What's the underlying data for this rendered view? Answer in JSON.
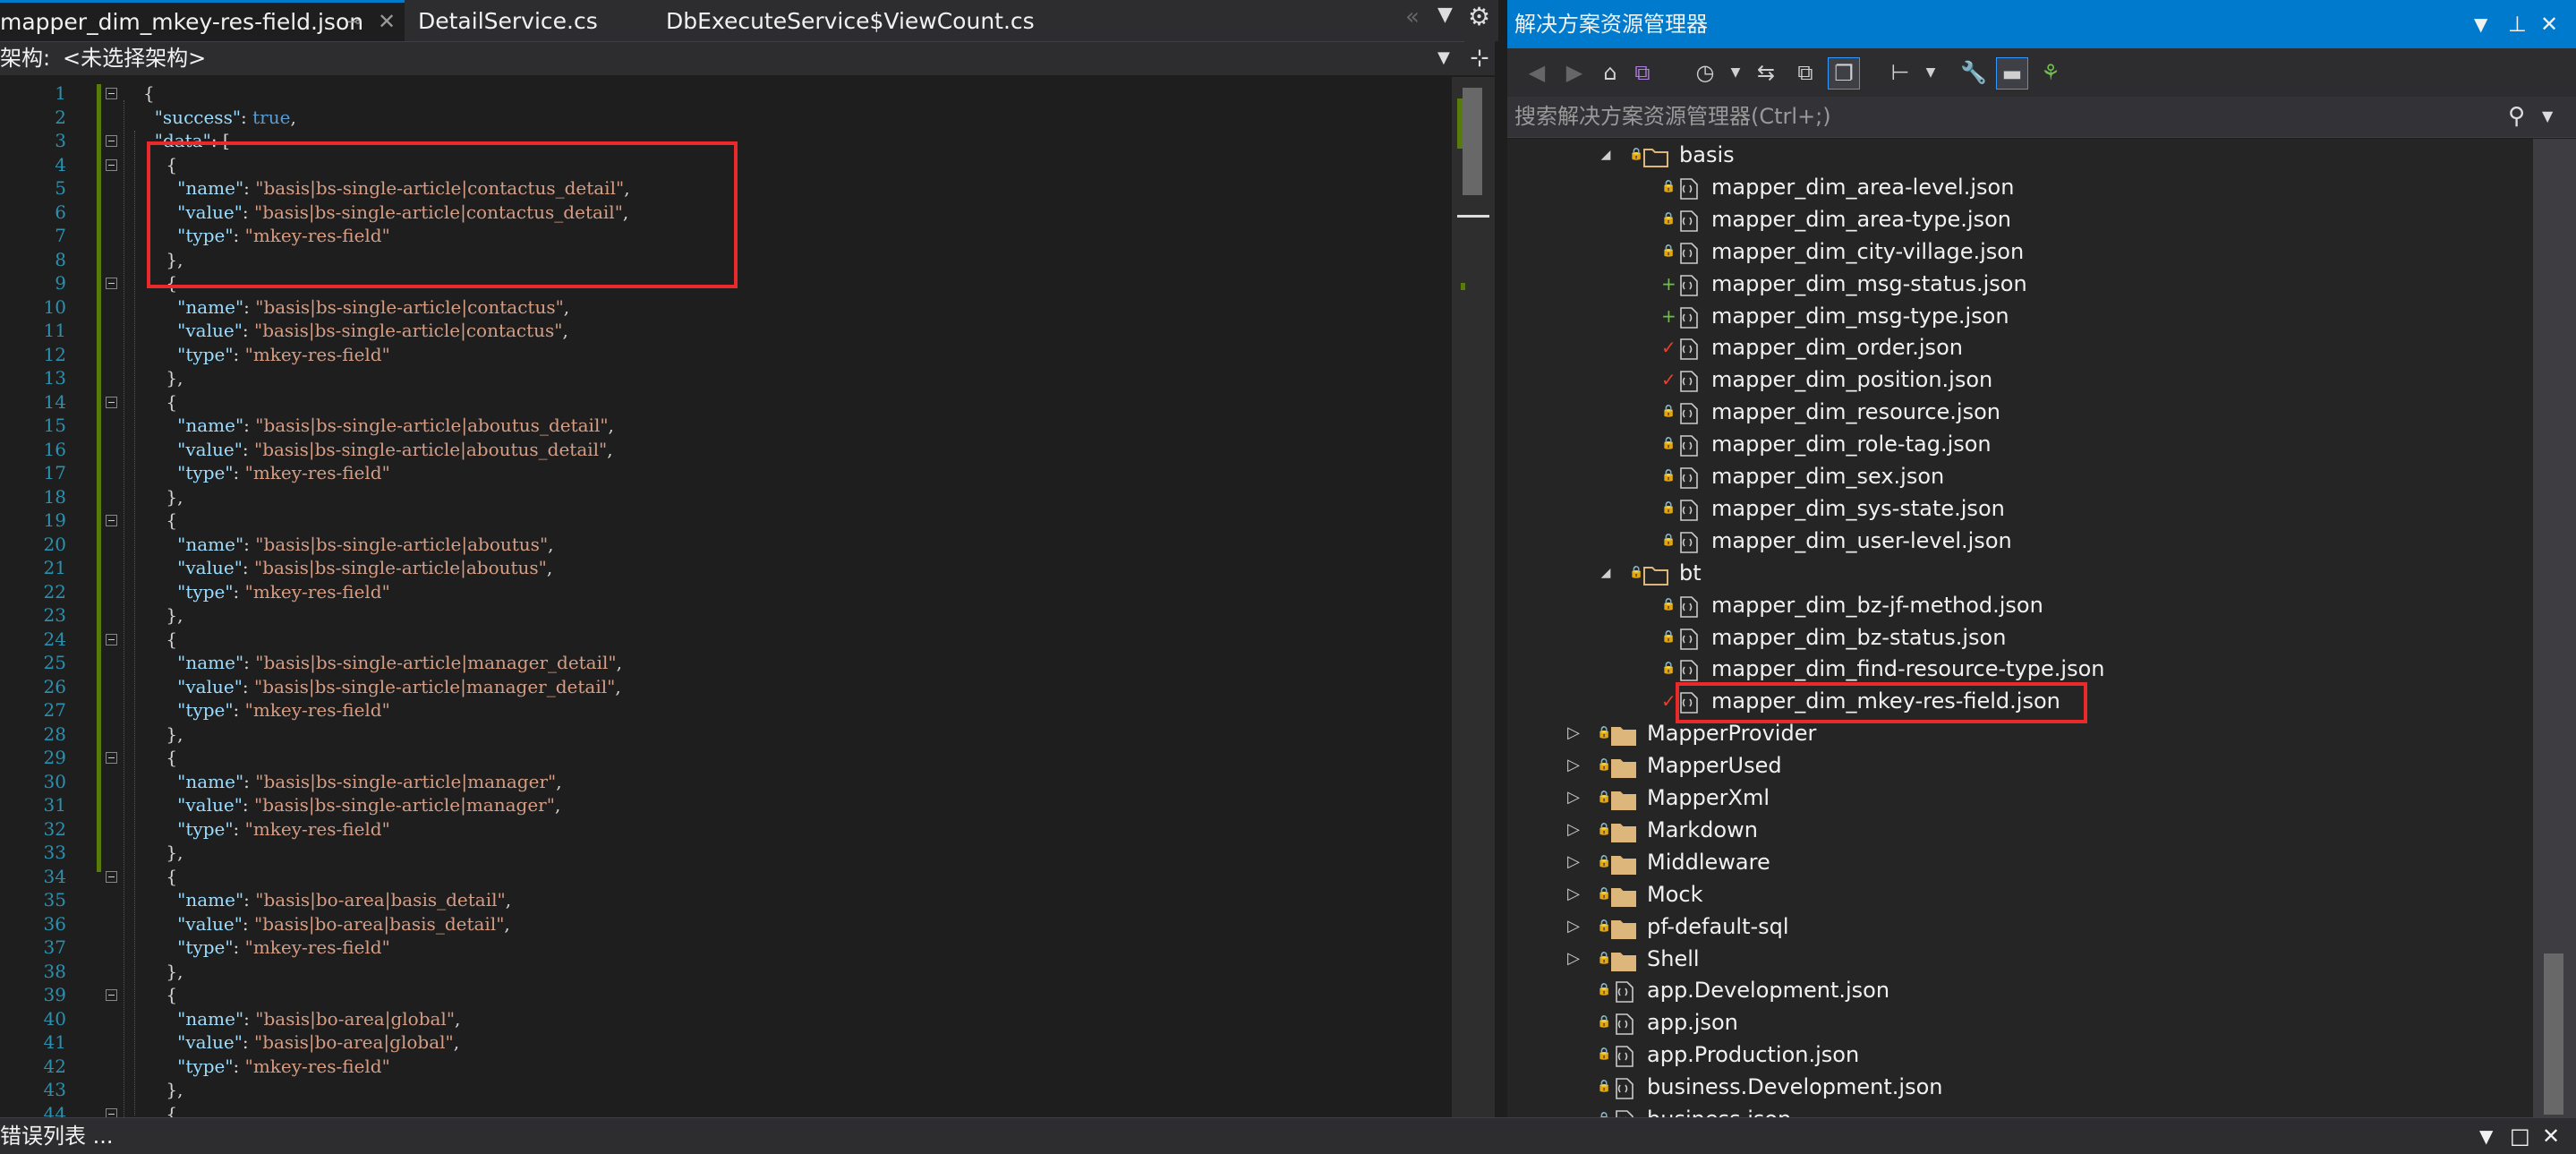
{
  "editor": {
    "tabs": [
      {
        "label": "mapper_dim_mkey-res-field.json"
      },
      {
        "label": "DetailService.cs"
      },
      {
        "label": "DbExecuteService$ViewCount.cs"
      }
    ],
    "nav_label": "架构:",
    "nav_value": "<未选择架构>",
    "lines": [
      {
        "n": "1",
        "t": [
          {
            "c": "",
            "v": "{"
          }
        ]
      },
      {
        "n": "2",
        "t": [
          {
            "c": "",
            "v": "  "
          },
          {
            "c": "k",
            "v": "\"success\""
          },
          {
            "c": "",
            "v": ": "
          },
          {
            "c": "b",
            "v": "true"
          },
          {
            "c": "",
            "v": ","
          }
        ]
      },
      {
        "n": "3",
        "t": [
          {
            "c": "",
            "v": "  "
          },
          {
            "c": "k",
            "v": "\"data\""
          },
          {
            "c": "",
            "v": ": ["
          }
        ]
      },
      {
        "n": "4",
        "t": [
          {
            "c": "",
            "v": "    {"
          }
        ]
      },
      {
        "n": "5",
        "t": [
          {
            "c": "",
            "v": "      "
          },
          {
            "c": "k",
            "v": "\"name\""
          },
          {
            "c": "",
            "v": ": "
          },
          {
            "c": "s",
            "v": "\"basis|bs-single-article|contactus_detail\""
          },
          {
            "c": "",
            "v": ","
          }
        ]
      },
      {
        "n": "6",
        "t": [
          {
            "c": "",
            "v": "      "
          },
          {
            "c": "k",
            "v": "\"value\""
          },
          {
            "c": "",
            "v": ": "
          },
          {
            "c": "s",
            "v": "\"basis|bs-single-article|contactus_detail\""
          },
          {
            "c": "",
            "v": ","
          }
        ]
      },
      {
        "n": "7",
        "t": [
          {
            "c": "",
            "v": "      "
          },
          {
            "c": "k",
            "v": "\"type\""
          },
          {
            "c": "",
            "v": ": "
          },
          {
            "c": "s",
            "v": "\"mkey-res-field\""
          }
        ]
      },
      {
        "n": "8",
        "t": [
          {
            "c": "",
            "v": "    },"
          }
        ]
      },
      {
        "n": "9",
        "t": [
          {
            "c": "",
            "v": "    {"
          }
        ]
      },
      {
        "n": "10",
        "t": [
          {
            "c": "",
            "v": "      "
          },
          {
            "c": "k",
            "v": "\"name\""
          },
          {
            "c": "",
            "v": ": "
          },
          {
            "c": "s",
            "v": "\"basis|bs-single-article|contactus\""
          },
          {
            "c": "",
            "v": ","
          }
        ]
      },
      {
        "n": "11",
        "t": [
          {
            "c": "",
            "v": "      "
          },
          {
            "c": "k",
            "v": "\"value\""
          },
          {
            "c": "",
            "v": ": "
          },
          {
            "c": "s",
            "v": "\"basis|bs-single-article|contactus\""
          },
          {
            "c": "",
            "v": ","
          }
        ]
      },
      {
        "n": "12",
        "t": [
          {
            "c": "",
            "v": "      "
          },
          {
            "c": "k",
            "v": "\"type\""
          },
          {
            "c": "",
            "v": ": "
          },
          {
            "c": "s",
            "v": "\"mkey-res-field\""
          }
        ]
      },
      {
        "n": "13",
        "t": [
          {
            "c": "",
            "v": "    },"
          }
        ]
      },
      {
        "n": "14",
        "t": [
          {
            "c": "",
            "v": "    {"
          }
        ]
      },
      {
        "n": "15",
        "t": [
          {
            "c": "",
            "v": "      "
          },
          {
            "c": "k",
            "v": "\"name\""
          },
          {
            "c": "",
            "v": ": "
          },
          {
            "c": "s",
            "v": "\"basis|bs-single-article|aboutus_detail\""
          },
          {
            "c": "",
            "v": ","
          }
        ]
      },
      {
        "n": "16",
        "t": [
          {
            "c": "",
            "v": "      "
          },
          {
            "c": "k",
            "v": "\"value\""
          },
          {
            "c": "",
            "v": ": "
          },
          {
            "c": "s",
            "v": "\"basis|bs-single-article|aboutus_detail\""
          },
          {
            "c": "",
            "v": ","
          }
        ]
      },
      {
        "n": "17",
        "t": [
          {
            "c": "",
            "v": "      "
          },
          {
            "c": "k",
            "v": "\"type\""
          },
          {
            "c": "",
            "v": ": "
          },
          {
            "c": "s",
            "v": "\"mkey-res-field\""
          }
        ]
      },
      {
        "n": "18",
        "t": [
          {
            "c": "",
            "v": "    },"
          }
        ]
      },
      {
        "n": "19",
        "t": [
          {
            "c": "",
            "v": "    {"
          }
        ]
      },
      {
        "n": "20",
        "t": [
          {
            "c": "",
            "v": "      "
          },
          {
            "c": "k",
            "v": "\"name\""
          },
          {
            "c": "",
            "v": ": "
          },
          {
            "c": "s",
            "v": "\"basis|bs-single-article|aboutus\""
          },
          {
            "c": "",
            "v": ","
          }
        ]
      },
      {
        "n": "21",
        "t": [
          {
            "c": "",
            "v": "      "
          },
          {
            "c": "k",
            "v": "\"value\""
          },
          {
            "c": "",
            "v": ": "
          },
          {
            "c": "s",
            "v": "\"basis|bs-single-article|aboutus\""
          },
          {
            "c": "",
            "v": ","
          }
        ]
      },
      {
        "n": "22",
        "t": [
          {
            "c": "",
            "v": "      "
          },
          {
            "c": "k",
            "v": "\"type\""
          },
          {
            "c": "",
            "v": ": "
          },
          {
            "c": "s",
            "v": "\"mkey-res-field\""
          }
        ]
      },
      {
        "n": "23",
        "t": [
          {
            "c": "",
            "v": "    },"
          }
        ]
      },
      {
        "n": "24",
        "t": [
          {
            "c": "",
            "v": "    {"
          }
        ]
      },
      {
        "n": "25",
        "t": [
          {
            "c": "",
            "v": "      "
          },
          {
            "c": "k",
            "v": "\"name\""
          },
          {
            "c": "",
            "v": ": "
          },
          {
            "c": "s",
            "v": "\"basis|bs-single-article|manager_detail\""
          },
          {
            "c": "",
            "v": ","
          }
        ]
      },
      {
        "n": "26",
        "t": [
          {
            "c": "",
            "v": "      "
          },
          {
            "c": "k",
            "v": "\"value\""
          },
          {
            "c": "",
            "v": ": "
          },
          {
            "c": "s",
            "v": "\"basis|bs-single-article|manager_detail\""
          },
          {
            "c": "",
            "v": ","
          }
        ]
      },
      {
        "n": "27",
        "t": [
          {
            "c": "",
            "v": "      "
          },
          {
            "c": "k",
            "v": "\"type\""
          },
          {
            "c": "",
            "v": ": "
          },
          {
            "c": "s",
            "v": "\"mkey-res-field\""
          }
        ]
      },
      {
        "n": "28",
        "t": [
          {
            "c": "",
            "v": "    },"
          }
        ]
      },
      {
        "n": "29",
        "t": [
          {
            "c": "",
            "v": "    {"
          }
        ]
      },
      {
        "n": "30",
        "t": [
          {
            "c": "",
            "v": "      "
          },
          {
            "c": "k",
            "v": "\"name\""
          },
          {
            "c": "",
            "v": ": "
          },
          {
            "c": "s",
            "v": "\"basis|bs-single-article|manager\""
          },
          {
            "c": "",
            "v": ","
          }
        ]
      },
      {
        "n": "31",
        "t": [
          {
            "c": "",
            "v": "      "
          },
          {
            "c": "k",
            "v": "\"value\""
          },
          {
            "c": "",
            "v": ": "
          },
          {
            "c": "s",
            "v": "\"basis|bs-single-article|manager\""
          },
          {
            "c": "",
            "v": ","
          }
        ]
      },
      {
        "n": "32",
        "t": [
          {
            "c": "",
            "v": "      "
          },
          {
            "c": "k",
            "v": "\"type\""
          },
          {
            "c": "",
            "v": ": "
          },
          {
            "c": "s",
            "v": "\"mkey-res-field\""
          }
        ]
      },
      {
        "n": "33",
        "t": [
          {
            "c": "",
            "v": "    },"
          }
        ]
      },
      {
        "n": "34",
        "t": [
          {
            "c": "",
            "v": "    {"
          }
        ]
      },
      {
        "n": "35",
        "t": [
          {
            "c": "",
            "v": "      "
          },
          {
            "c": "k",
            "v": "\"name\""
          },
          {
            "c": "",
            "v": ": "
          },
          {
            "c": "s",
            "v": "\"basis|bo-area|basis_detail\""
          },
          {
            "c": "",
            "v": ","
          }
        ]
      },
      {
        "n": "36",
        "t": [
          {
            "c": "",
            "v": "      "
          },
          {
            "c": "k",
            "v": "\"value\""
          },
          {
            "c": "",
            "v": ": "
          },
          {
            "c": "s",
            "v": "\"basis|bo-area|basis_detail\""
          },
          {
            "c": "",
            "v": ","
          }
        ]
      },
      {
        "n": "37",
        "t": [
          {
            "c": "",
            "v": "      "
          },
          {
            "c": "k",
            "v": "\"type\""
          },
          {
            "c": "",
            "v": ": "
          },
          {
            "c": "s",
            "v": "\"mkey-res-field\""
          }
        ]
      },
      {
        "n": "38",
        "t": [
          {
            "c": "",
            "v": "    },"
          }
        ]
      },
      {
        "n": "39",
        "t": [
          {
            "c": "",
            "v": "    {"
          }
        ]
      },
      {
        "n": "40",
        "t": [
          {
            "c": "",
            "v": "      "
          },
          {
            "c": "k",
            "v": "\"name\""
          },
          {
            "c": "",
            "v": ": "
          },
          {
            "c": "s",
            "v": "\"basis|bo-area|global\""
          },
          {
            "c": "",
            "v": ","
          }
        ]
      },
      {
        "n": "41",
        "t": [
          {
            "c": "",
            "v": "      "
          },
          {
            "c": "k",
            "v": "\"value\""
          },
          {
            "c": "",
            "v": ": "
          },
          {
            "c": "s",
            "v": "\"basis|bo-area|global\""
          },
          {
            "c": "",
            "v": ","
          }
        ]
      },
      {
        "n": "42",
        "t": [
          {
            "c": "",
            "v": "      "
          },
          {
            "c": "k",
            "v": "\"type\""
          },
          {
            "c": "",
            "v": ": "
          },
          {
            "c": "s",
            "v": "\"mkey-res-field\""
          }
        ]
      },
      {
        "n": "43",
        "t": [
          {
            "c": "",
            "v": "    },"
          }
        ]
      },
      {
        "n": "44",
        "t": [
          {
            "c": "",
            "v": "    {"
          }
        ]
      }
    ]
  },
  "solution_explorer": {
    "title": "解决方案资源管理器",
    "search_placeholder": "搜索解决方案资源管理器(Ctrl+;)",
    "tree": [
      {
        "level": 1,
        "kind": "folder",
        "label": "basis",
        "expanded": true,
        "lock": true
      },
      {
        "level": 2,
        "kind": "file",
        "label": "mapper_dim_area-level.json",
        "status": "lock"
      },
      {
        "level": 2,
        "kind": "file",
        "label": "mapper_dim_area-type.json",
        "status": "lock"
      },
      {
        "level": 2,
        "kind": "file",
        "label": "mapper_dim_city-village.json",
        "status": "lock"
      },
      {
        "level": 2,
        "kind": "file",
        "label": "mapper_dim_msg-status.json",
        "status": "add"
      },
      {
        "level": 2,
        "kind": "file",
        "label": "mapper_dim_msg-type.json",
        "status": "add"
      },
      {
        "level": 2,
        "kind": "file",
        "label": "mapper_dim_order.json",
        "status": "check"
      },
      {
        "level": 2,
        "kind": "file",
        "label": "mapper_dim_position.json",
        "status": "check"
      },
      {
        "level": 2,
        "kind": "file",
        "label": "mapper_dim_resource.json",
        "status": "lock"
      },
      {
        "level": 2,
        "kind": "file",
        "label": "mapper_dim_role-tag.json",
        "status": "lock"
      },
      {
        "level": 2,
        "kind": "file",
        "label": "mapper_dim_sex.json",
        "status": "lock"
      },
      {
        "level": 2,
        "kind": "file",
        "label": "mapper_dim_sys-state.json",
        "status": "lock"
      },
      {
        "level": 2,
        "kind": "file",
        "label": "mapper_dim_user-level.json",
        "status": "lock"
      },
      {
        "level": 1,
        "kind": "folder",
        "label": "bt",
        "expanded": true,
        "lock": true
      },
      {
        "level": 2,
        "kind": "file",
        "label": "mapper_dim_bz-jf-method.json",
        "status": "lock"
      },
      {
        "level": 2,
        "kind": "file",
        "label": "mapper_dim_bz-status.json",
        "status": "lock"
      },
      {
        "level": 2,
        "kind": "file",
        "label": "mapper_dim_find-resource-type.json",
        "status": "lock"
      },
      {
        "level": 2,
        "kind": "file",
        "label": "mapper_dim_mkey-res-field.json",
        "status": "check",
        "highlight": true
      },
      {
        "level": 0,
        "kind": "folder",
        "label": "MapperProvider",
        "expanded": false,
        "lock": true
      },
      {
        "level": 0,
        "kind": "folder",
        "label": "MapperUsed",
        "expanded": false,
        "lock": true
      },
      {
        "level": 0,
        "kind": "folder",
        "label": "MapperXml",
        "expanded": false,
        "lock": true
      },
      {
        "level": 0,
        "kind": "folder",
        "label": "Markdown",
        "expanded": false,
        "lock": true
      },
      {
        "level": 0,
        "kind": "folder",
        "label": "Middleware",
        "expanded": false,
        "lock": true
      },
      {
        "level": 0,
        "kind": "folder",
        "label": "Mock",
        "expanded": false,
        "lock": true
      },
      {
        "level": 0,
        "kind": "folder",
        "label": "pf-default-sql",
        "expanded": false,
        "lock": true
      },
      {
        "level": 0,
        "kind": "folder",
        "label": "Shell",
        "expanded": false,
        "lock": true
      },
      {
        "level": 0,
        "kind": "file",
        "label": "app.Development.json",
        "status": "lock"
      },
      {
        "level": 0,
        "kind": "file",
        "label": "app.json",
        "status": "lock"
      },
      {
        "level": 0,
        "kind": "file",
        "label": "app.Production.json",
        "status": "lock"
      },
      {
        "level": 0,
        "kind": "file",
        "label": "business.Development.json",
        "status": "lock"
      },
      {
        "level": 0,
        "kind": "file",
        "label": "business.json",
        "status": "lock"
      }
    ]
  },
  "status_bar": {
    "label": "错误列表 ..."
  },
  "colors": {
    "accent": "#007acc",
    "highlight_box": "#e82a2a",
    "lock": "#4ea6f5",
    "add": "#6fbf4a",
    "check": "#e8412a"
  },
  "icons": [
    "pin-icon",
    "close-icon",
    "dropdown-icon",
    "gear-icon",
    "split-icon",
    "back-icon",
    "forward-icon",
    "home-icon",
    "vs-icon",
    "sync-icon",
    "history-icon",
    "refresh-icon",
    "collapse-icon",
    "show-all-files-icon",
    "properties-icon",
    "wrench-icon",
    "preview-icon",
    "graph-icon",
    "search-icon",
    "maximize-icon"
  ]
}
